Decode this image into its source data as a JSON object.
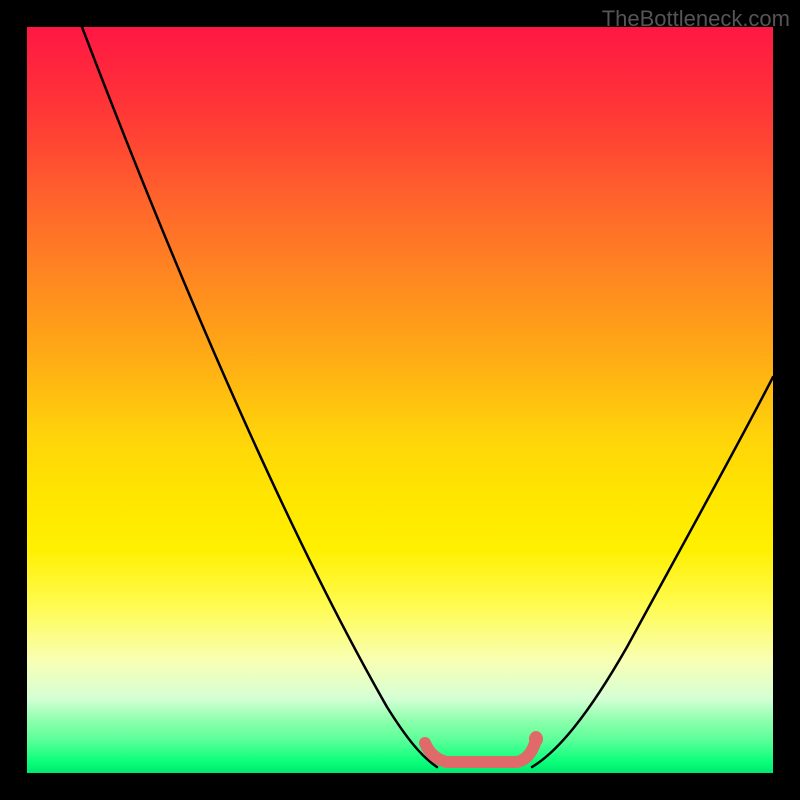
{
  "watermark": "TheBottleneck.com",
  "chart_data": {
    "type": "line",
    "title": "",
    "xlabel": "",
    "ylabel": "",
    "xlim": [
      0,
      100
    ],
    "ylim": [
      0,
      100
    ],
    "grid": false,
    "background": "red-yellow-green vertical gradient (red=high bottleneck, green=low bottleneck)",
    "series": [
      {
        "name": "bottleneck-curve",
        "color": "#000000",
        "x": [
          0,
          5,
          10,
          15,
          20,
          25,
          30,
          35,
          40,
          45,
          50,
          53,
          56,
          58,
          60,
          62,
          65,
          70,
          75,
          80,
          85,
          90,
          95,
          100
        ],
        "y": [
          100,
          92,
          84,
          76,
          68,
          59,
          50,
          41,
          32,
          22,
          12,
          6,
          2,
          0.5,
          0,
          0,
          0.5,
          2,
          6,
          14,
          24,
          35,
          45,
          55
        ]
      },
      {
        "name": "optimal-zone-marker",
        "color": "#e06a6a",
        "x": [
          53,
          54,
          55,
          57,
          59,
          61,
          63,
          65,
          66,
          67
        ],
        "y": [
          4,
          2.5,
          1.5,
          1,
          1,
          1,
          1,
          1.5,
          2.5,
          4
        ]
      }
    ],
    "annotations": []
  }
}
